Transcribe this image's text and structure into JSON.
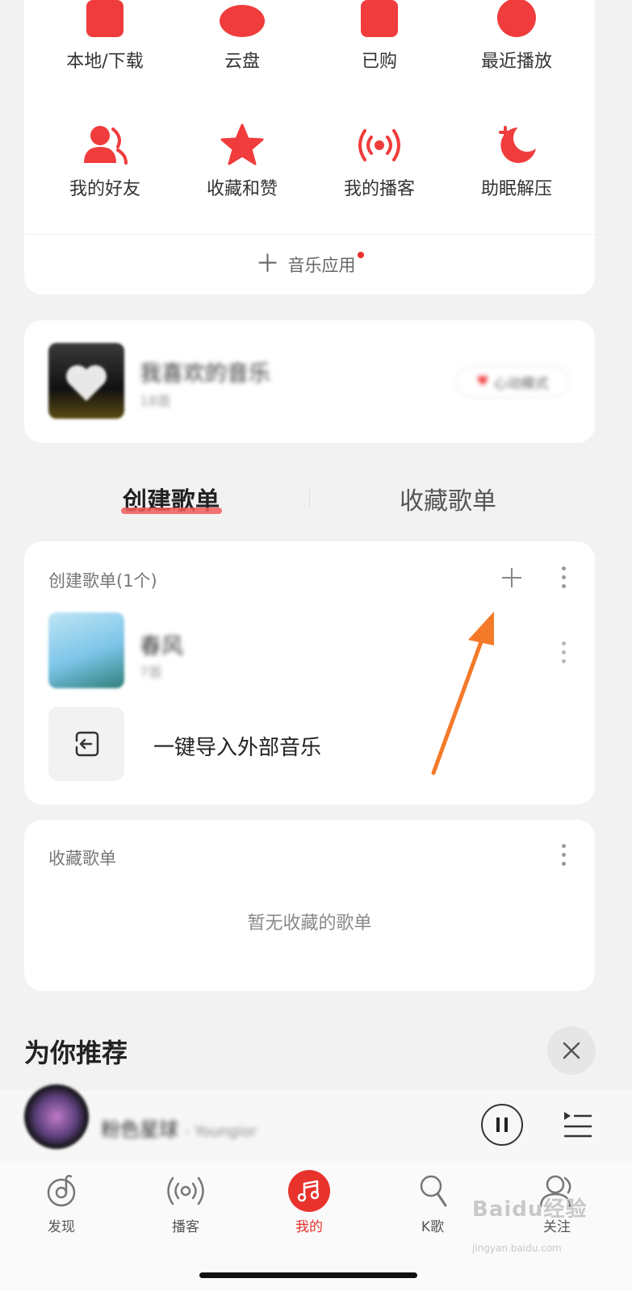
{
  "quick_actions": [
    {
      "label": "本地/下载",
      "icon": "download-icon"
    },
    {
      "label": "云盘",
      "icon": "cloud-icon"
    },
    {
      "label": "已购",
      "icon": "purchased-icon"
    },
    {
      "label": "最近播放",
      "icon": "recent-icon"
    },
    {
      "label": "我的好友",
      "icon": "friends-icon"
    },
    {
      "label": "收藏和赞",
      "icon": "star-icon"
    },
    {
      "label": "我的播客",
      "icon": "podcast-icon"
    },
    {
      "label": "助眠解压",
      "icon": "moon-icon"
    }
  ],
  "music_apps": {
    "label": "音乐应用"
  },
  "liked_music": {
    "title": "我喜欢的音乐",
    "count": "18首",
    "heart_mode": "心动模式"
  },
  "tabs": {
    "created": "创建歌单",
    "collected": "收藏歌单"
  },
  "created_section": {
    "title": "创建歌单(1个)",
    "playlists": [
      {
        "name": "春风",
        "count": "7首"
      }
    ],
    "import_label": "一键导入外部音乐"
  },
  "collected_section": {
    "title": "收藏歌单",
    "empty_text": "暂无收藏的歌单"
  },
  "recommend": {
    "title": "为你推荐"
  },
  "player": {
    "song": "粉色星球",
    "artist": "- Youngior"
  },
  "bottom_nav": [
    {
      "label": "发现"
    },
    {
      "label": "播客"
    },
    {
      "label": "我的"
    },
    {
      "label": "K歌"
    },
    {
      "label": "关注"
    }
  ],
  "watermark": {
    "text": "Baidu经验",
    "url": "jingyan.baidu.com"
  },
  "colors": {
    "accent": "#e8332d",
    "annotation_arrow": "#f47a2a"
  }
}
